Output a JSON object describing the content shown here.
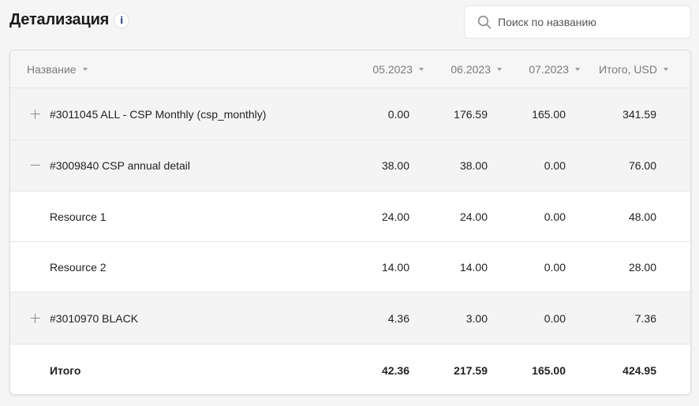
{
  "header": {
    "title": "Детализация",
    "info_glyph": "i",
    "search_placeholder": "Поиск по названию",
    "search_value": ""
  },
  "table": {
    "columns": [
      "Название",
      "05.2023",
      "06.2023",
      "07.2023",
      "Итого, USD"
    ],
    "rows": [
      {
        "name": "#3011045 ALL - CSP Monthly (csp_monthly)",
        "toggle": "expand",
        "values": [
          "0.00",
          "176.59",
          "165.00",
          "341.59"
        ]
      },
      {
        "name": "#3009840 CSP annual detail",
        "toggle": "collapse",
        "values": [
          "38.00",
          "38.00",
          "0.00",
          "76.00"
        ]
      },
      {
        "name": "Resource 1",
        "toggle": "none",
        "values": [
          "24.00",
          "24.00",
          "0.00",
          "48.00"
        ]
      },
      {
        "name": "Resource 2",
        "toggle": "none",
        "values": [
          "14.00",
          "14.00",
          "0.00",
          "28.00"
        ]
      },
      {
        "name": "#3010970 BLACK",
        "toggle": "expand",
        "values": [
          "4.36",
          "3.00",
          "0.00",
          "7.36"
        ]
      }
    ],
    "total": {
      "name": "Итого",
      "values": [
        "42.36",
        "217.59",
        "165.00",
        "424.95"
      ]
    }
  },
  "colors": {
    "background": "#f5f5f5",
    "header_row": "#f6f6f6",
    "group_row": "#f4f4f4",
    "accent_info": "#2a4a8a"
  },
  "icons": [
    "info-icon",
    "search-icon",
    "sort-down-icon",
    "plus-icon",
    "minus-icon"
  ]
}
